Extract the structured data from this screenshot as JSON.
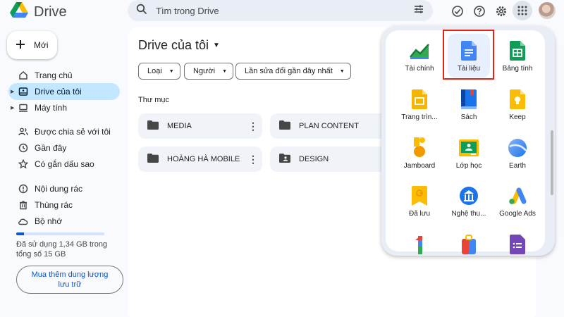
{
  "header": {
    "app_name": "Drive",
    "search_placeholder": "Tìm trong Drive"
  },
  "sidebar": {
    "new_label": "Mới",
    "items": [
      {
        "label": "Trang chủ",
        "icon": "home-icon"
      },
      {
        "label": "Drive của tôi",
        "icon": "my-drive-icon",
        "active": true
      },
      {
        "label": "Máy tính",
        "icon": "computer-icon"
      },
      {
        "label": "Được chia sẻ với tôi",
        "icon": "shared-icon"
      },
      {
        "label": "Gần đây",
        "icon": "clock-icon"
      },
      {
        "label": "Có gắn dấu sao",
        "icon": "star-icon"
      },
      {
        "label": "Nội dung rác",
        "icon": "spam-icon"
      },
      {
        "label": "Thùng rác",
        "icon": "trash-icon"
      },
      {
        "label": "Bộ nhớ",
        "icon": "cloud-icon"
      }
    ],
    "storage_text": "Đã sử dụng 1,34 GB trong tổng số 15 GB",
    "storage_used_fraction": 0.09,
    "buy_storage_label": "Mua thêm dung lượng lưu trữ"
  },
  "main": {
    "title": "Drive của tôi",
    "filters": [
      "Loại",
      "Người",
      "Lần sửa đổi gần đây nhất"
    ],
    "folders_label": "Thư mục",
    "folders": [
      {
        "name": "MEDIA",
        "shared": false
      },
      {
        "name": "PLAN CONTENT",
        "shared": false
      },
      {
        "name": "HOÀNG HÀ MOBILE",
        "shared": false
      },
      {
        "name": "DESIGN",
        "shared": true
      }
    ]
  },
  "apps_panel": {
    "apps": [
      {
        "label": "Tài chính",
        "icon": "finance-icon"
      },
      {
        "label": "Tài liệu",
        "icon": "docs-icon",
        "highlighted": true
      },
      {
        "label": "Bảng tính",
        "icon": "sheets-icon"
      },
      {
        "label": "Trang trìn...",
        "icon": "slides-icon"
      },
      {
        "label": "Sách",
        "icon": "books-icon"
      },
      {
        "label": "Keep",
        "icon": "keep-icon"
      },
      {
        "label": "Jamboard",
        "icon": "jamboard-icon"
      },
      {
        "label": "Lớp học",
        "icon": "classroom-icon"
      },
      {
        "label": "Earth",
        "icon": "earth-icon"
      },
      {
        "label": "Đã lưu",
        "icon": "saved-icon"
      },
      {
        "label": "Nghệ thu...",
        "icon": "arts-culture-icon"
      },
      {
        "label": "Google Ads",
        "icon": "google-ads-icon"
      }
    ]
  },
  "colors": {
    "accent": "#0b57d0",
    "active_nav": "#c2e7ff",
    "highlight_border": "#e2231a"
  }
}
